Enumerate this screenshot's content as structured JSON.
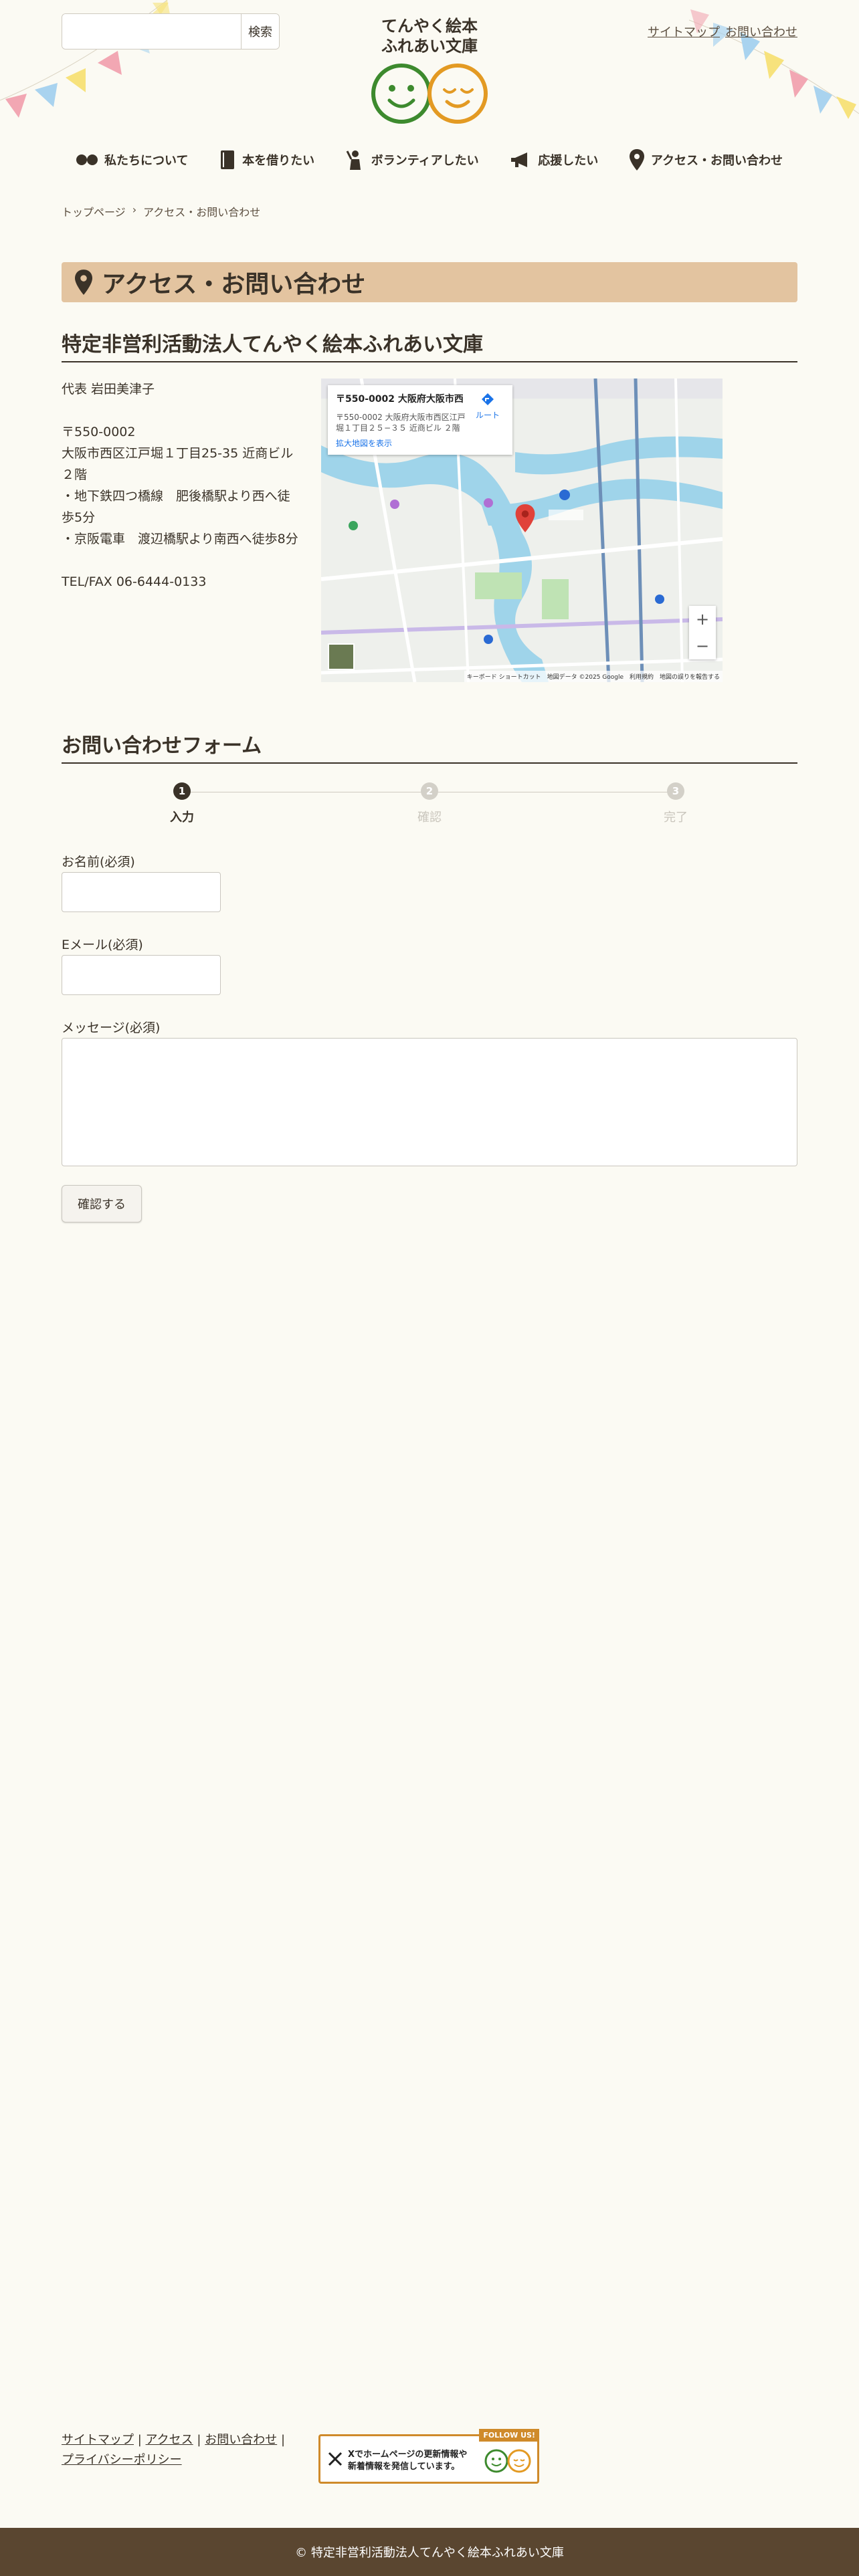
{
  "header": {
    "search_placeholder": "",
    "search_button": "検索",
    "links": [
      "サイトマップ",
      "お問い合わせ"
    ],
    "logo_lines": [
      "てんやく絵本",
      "ふれあい文庫"
    ]
  },
  "nav": [
    {
      "label": "私たちについて",
      "icon": "dots-icon"
    },
    {
      "label": "本を借りたい",
      "icon": "book-icon"
    },
    {
      "label": "ボランティアしたい",
      "icon": "volunteer-icon"
    },
    {
      "label": "応援したい",
      "icon": "megaphone-icon"
    },
    {
      "label": "アクセス・お問い合わせ",
      "icon": "map-pin-icon"
    }
  ],
  "breadcrumb": {
    "home": "トップページ",
    "separator": "›",
    "current": "アクセス・お問い合わせ"
  },
  "page_title": "アクセス・お問い合わせ",
  "org": {
    "title": "特定非営利活動法人てんやく絵本ふれあい文庫",
    "representative": "代表 岩田美津子",
    "postal": "〒550-0002",
    "address": "大阪市西区江戸堀１丁目25-35 近商ビル２階",
    "access1": "・地下鉄四つ橋線　肥後橋駅より西へ徒歩5分",
    "access2": "・京阪電車　渡辺橋駅より南西へ徒歩8分",
    "tel": "TEL/FAX 06-6444-0133"
  },
  "map": {
    "card_title": "〒550-0002 大阪府大阪市西区...",
    "card_address": "〒550-0002 大阪府大阪市西区江戸堀１丁目２５−３５ 近商ビル ２階",
    "route_label": "ルート",
    "enlarge_label": "拡大地図を表示",
    "zoom_in": "+",
    "zoom_out": "−",
    "footer": "キーボード ショートカット　地図データ ©2025 Google　利用規約　地図の誤りを報告する"
  },
  "form": {
    "title": "お問い合わせフォーム",
    "steps": [
      {
        "num": "1",
        "label": "入力"
      },
      {
        "num": "2",
        "label": "確認"
      },
      {
        "num": "3",
        "label": "完了"
      }
    ],
    "name_label": "お名前(必須)",
    "email_label": "Eメール(必須)",
    "message_label": "メッセージ(必須)",
    "submit": "確認する"
  },
  "footer": {
    "links": [
      "サイトマップ",
      "アクセス",
      "お問い合わせ",
      "プライバシーポリシー"
    ],
    "separator": "|",
    "banner_badge": "FOLLOW US!",
    "banner_text1": "Xでホームページの更新情報や",
    "banner_text2": "新着情報を発信しています。",
    "copyright": "© 特定非営利活動法人てんやく絵本ふれあい文庫"
  },
  "colors": {
    "accent": "#e3c4a0",
    "footer_bg": "#5a4630",
    "text": "#3a3228",
    "face_green": "#3d8a2e",
    "face_orange": "#e39a23"
  }
}
